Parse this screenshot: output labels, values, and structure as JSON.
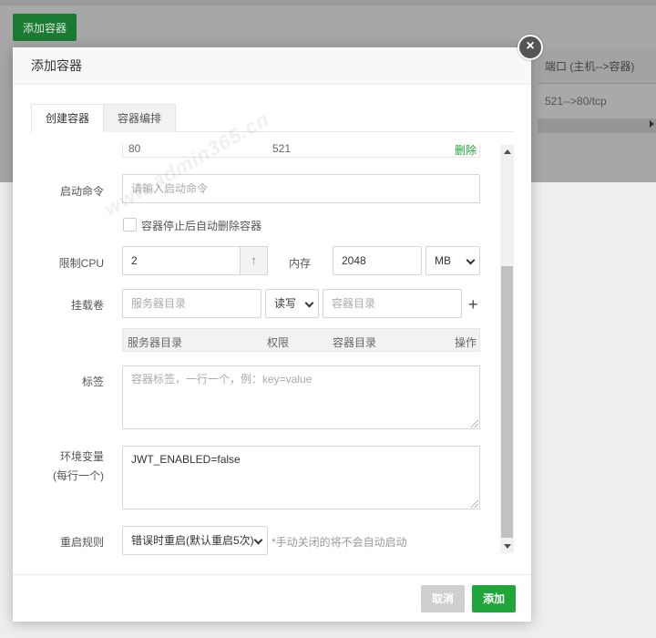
{
  "background": {
    "add_container_button": "添加容器",
    "table": {
      "port_header": "端口 (主机-->容器)",
      "port_value": "521-->80/tcp"
    }
  },
  "modal": {
    "title": "添加容器",
    "tabs": [
      {
        "label": "创建容器",
        "active": true
      },
      {
        "label": "容器编排",
        "active": false
      }
    ],
    "port_row": {
      "container_port": "80",
      "host_port": "521",
      "action": "删除"
    },
    "command": {
      "label": "启动命令",
      "placeholder": "请输入启动命令",
      "value": ""
    },
    "auto_remove": {
      "label": "容器停止后自动删除容器",
      "checked": false
    },
    "cpu": {
      "label": "限制CPU",
      "value": "2",
      "stepper_icon": "↑"
    },
    "memory": {
      "label": "内存",
      "value": "2048",
      "unit": "MB"
    },
    "volume": {
      "label": "挂载卷",
      "server_dir_placeholder": "服务器目录",
      "mode": "读写",
      "container_dir_placeholder": "容器目录",
      "add_icon": "+",
      "table_headers": [
        "服务器目录",
        "权限",
        "容器目录",
        "操作"
      ]
    },
    "labels": {
      "label": "标签",
      "placeholder": "容器标签，一行一个，例：key=value",
      "value": ""
    },
    "env": {
      "label_line1": "环境变量",
      "label_line2": "(每行一个)",
      "value": "JWT_ENABLED=false"
    },
    "restart": {
      "label": "重启规则",
      "selected": "错误时重启(默认重启5次)",
      "hint": "*手动关闭的将不会自动启动"
    },
    "buttons": {
      "cancel": "取消",
      "add": "添加"
    },
    "close_icon": "×"
  },
  "watermark": "www.admin365.cn",
  "colors": {
    "primary_green": "#20a53a",
    "dark_green": "#1a7a32",
    "overlay": "#a7a7a7"
  }
}
